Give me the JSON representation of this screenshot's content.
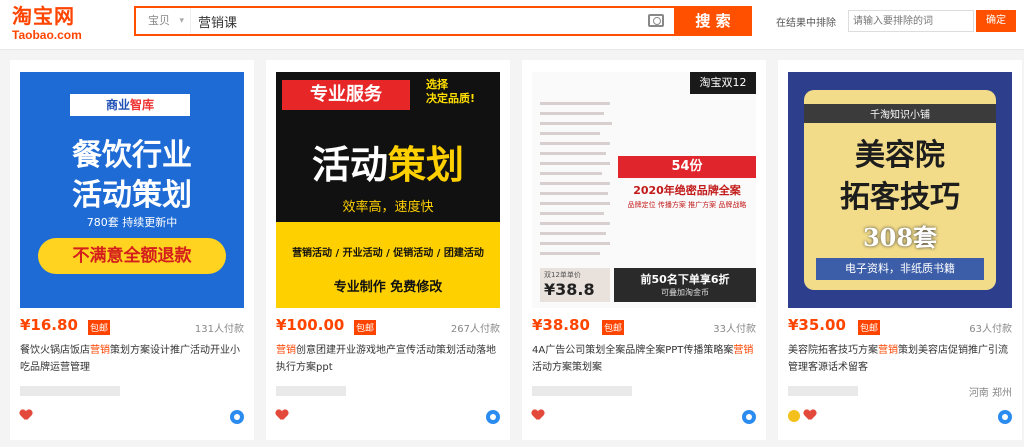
{
  "header": {
    "logo_cn": "淘宝网",
    "logo_en": "Taobao.com",
    "search_scope": "宝贝",
    "search_query": "营销课",
    "search_button": "搜 索",
    "refine_label": "在结果中排除",
    "refine_placeholder": "请输入要排除的词",
    "refine_button": "确定"
  },
  "products": [
    {
      "price": "¥16.80",
      "free_tag": "包邮",
      "sold": "131人付款",
      "title_pre": "餐饮火锅店饭店",
      "title_hl": "营销",
      "title_post": "策划方案设计推广活动开业小吃品牌运营管理",
      "location": "",
      "image": {
        "shop": "商业",
        "shop_hl": "智库",
        "line1": "餐饮行业",
        "line2": "活动策划",
        "sub": "780套 持续更新中",
        "pill": "不满意全额退款"
      }
    },
    {
      "price": "¥100.00",
      "free_tag": "包邮",
      "sold": "267人付款",
      "title_pre": "",
      "title_hl": "营销",
      "title_post": "创意团建开业游戏地产宣传活动策划活动落地执行方案ppt",
      "location": "",
      "image": {
        "banner": "专业服务",
        "slogan1": "选择",
        "slogan2": "决定品质!",
        "big1": "活动",
        "big2": "策划",
        "mid": "效率高，速度快",
        "line1": "营销活动 / 开业活动 / 促销活动 / 团建活动",
        "line2": "专业制作 免费修改"
      }
    },
    {
      "price": "¥38.80",
      "free_tag": "包邮",
      "sold": "33人付款",
      "title_pre": "4A广告公司策划全案品牌全案PPT传播策略案",
      "title_hl": "营销",
      "title_post": "活动方案策划案",
      "location": "",
      "image": {
        "tag": "淘宝双12",
        "count": "54份",
        "headline": "2020年绝密品牌全案",
        "small": "品牌定位 传播方案 推广方案 品牌战略",
        "price_label": "双12单单价",
        "price_value": "¥38.8",
        "promo1": "前50名下单享6折",
        "promo2": "可叠加淘金币"
      }
    },
    {
      "price": "¥35.00",
      "free_tag": "包邮",
      "sold": "63人付款",
      "title_pre": "美容院拓客技巧方案",
      "title_hl": "营销",
      "title_post": "策划美容店促销推广引流管理客源话术留客",
      "location": "河南 郑州",
      "image": {
        "top": "千淘知识小铺",
        "line1": "美容院",
        "line2": "拓客技巧",
        "count": "308套",
        "bottom": "电子资料，非纸质书籍"
      }
    }
  ]
}
